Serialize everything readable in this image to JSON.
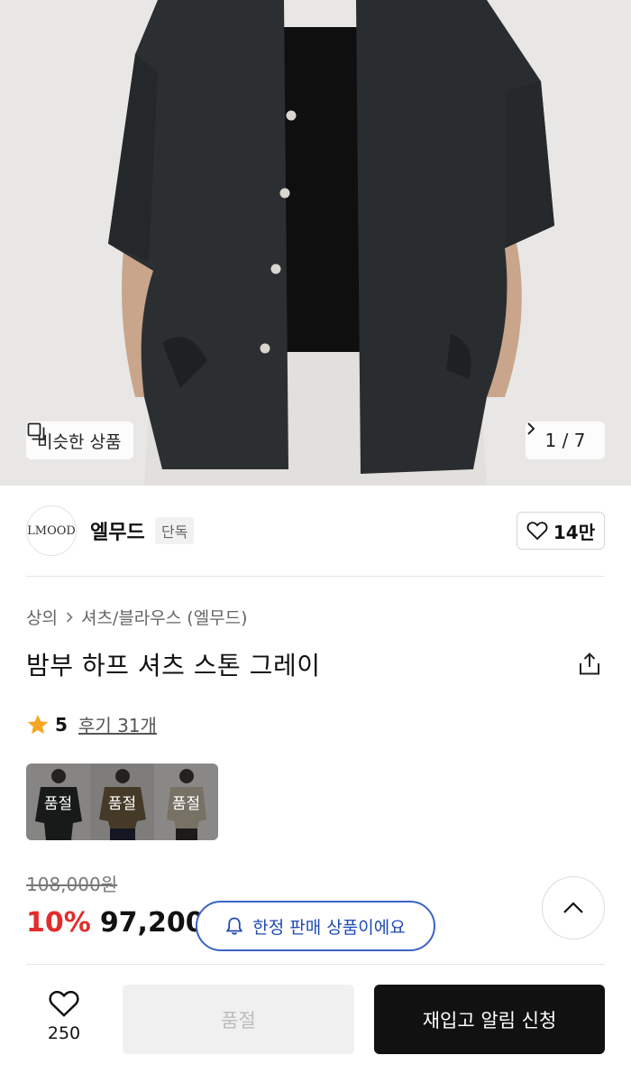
{
  "hero": {
    "similar_label": "비슷한 상품",
    "pager_text": "1 / 7"
  },
  "brand": {
    "logo_text": "LMOOD",
    "name": "엘무드",
    "badge": "단독",
    "likes": "14만"
  },
  "product": {
    "breadcrumb": [
      "상의",
      "셔츠/블라우스 (엘무드)"
    ],
    "title": "밤부 하프 셔츠 스톤 그레이",
    "rating": "5",
    "reviews_label": "후기 31개",
    "variants": [
      {
        "label": "품절",
        "shirt_color": "#2a2c2d"
      },
      {
        "label": "품절",
        "shirt_color": "#6b5a3e"
      },
      {
        "label": "품절",
        "shirt_color": "#b9ae9c"
      }
    ],
    "original_price": "108,000원",
    "discount": "10%",
    "price": "97,200원"
  },
  "toast": {
    "message": "한정 판매 상품이에요"
  },
  "bottom_bar": {
    "wish_count": "250",
    "soldout_label": "품절",
    "restock_label": "재입고 알림 신청"
  },
  "colors": {
    "accent_red": "#e02d2d",
    "toast_blue": "#1f49b4",
    "shirt": "#2a2e30",
    "star": "#f5a623"
  },
  "icons": [
    "similar-icon",
    "chevron-right-icon",
    "heart-icon",
    "share-icon",
    "star-icon",
    "chevron-up-icon",
    "bell-icon"
  ]
}
